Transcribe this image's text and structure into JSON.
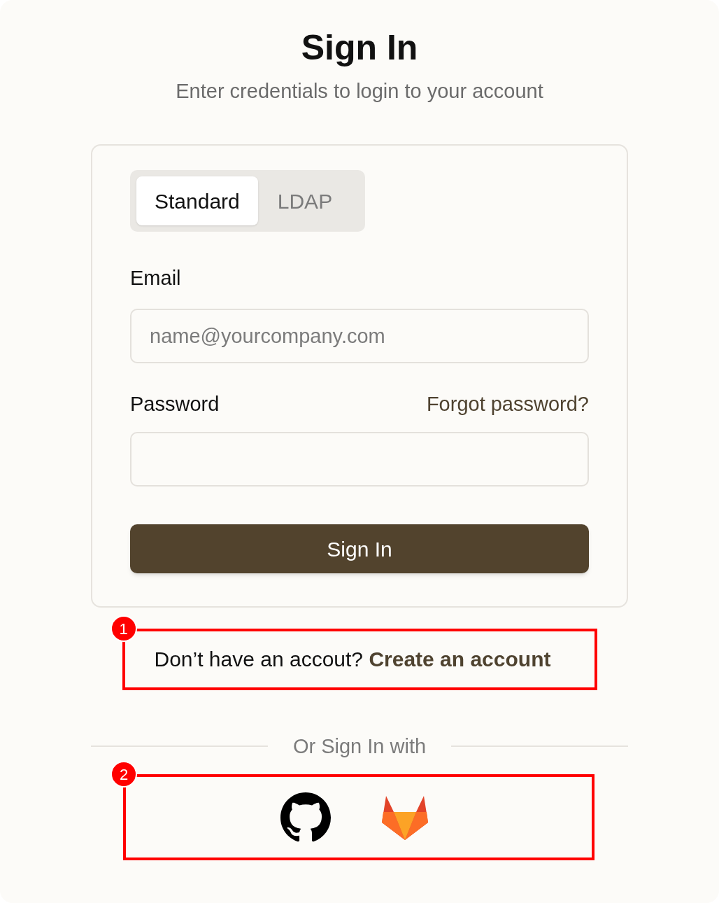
{
  "title": "Sign In",
  "subtitle": "Enter credentials to login to your account",
  "tabs": [
    {
      "label": "Standard",
      "selected": true
    },
    {
      "label": "LDAP",
      "selected": false
    }
  ],
  "email": {
    "label": "Email",
    "placeholder": "name@yourcompany.com"
  },
  "password": {
    "label": "Password",
    "forgot_link": "Forgot password?"
  },
  "submit_button": "Sign In",
  "signup": {
    "text": "Don’t have an accout?",
    "link": "Create an account"
  },
  "divider_text": "Or Sign In with",
  "annotations": [
    {
      "number": "1"
    },
    {
      "number": "2"
    }
  ]
}
